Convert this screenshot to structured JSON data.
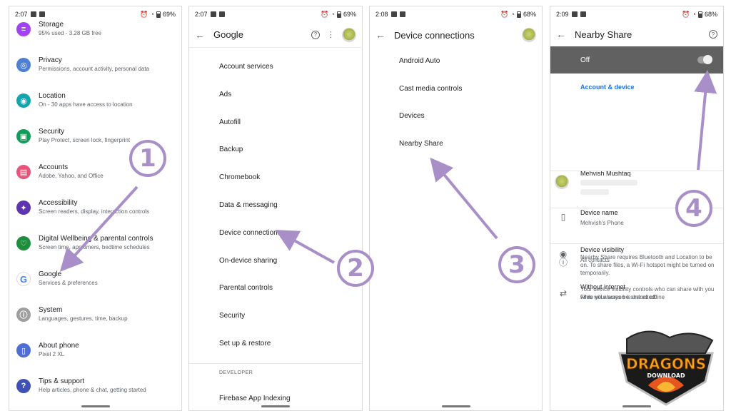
{
  "screens": [
    {
      "status": {
        "time": "2:07",
        "battery": "69%"
      },
      "items": [
        {
          "title": "Storage",
          "sub": "95% used - 3.28 GB free",
          "icon": "storage-icon",
          "color": "#a142f4"
        },
        {
          "title": "Privacy",
          "sub": "Permissions, account activity, personal data",
          "icon": "privacy-icon",
          "color": "#4e7fd6"
        },
        {
          "title": "Location",
          "sub": "On - 30 apps have access to location",
          "icon": "location-icon",
          "color": "#12a4af"
        },
        {
          "title": "Security",
          "sub": "Play Protect, screen lock, fingerprint",
          "icon": "security-icon",
          "color": "#0f9d58"
        },
        {
          "title": "Accounts",
          "sub": "Adobe, Yahoo, and Office",
          "icon": "accounts-icon",
          "color": "#e8537a"
        },
        {
          "title": "Accessibility",
          "sub": "Screen readers, display, interaction controls",
          "icon": "accessibility-icon",
          "color": "#5e35b1"
        },
        {
          "title": "Digital Wellbeing & parental controls",
          "sub": "Screen time, app timers, bedtime schedules",
          "icon": "wellbeing-icon",
          "color": "#1e8e3e"
        },
        {
          "title": "Google",
          "sub": "Services & preferences",
          "icon": "google-icon",
          "color": "#ffffff"
        },
        {
          "title": "System",
          "sub": "Languages, gestures, time, backup",
          "icon": "system-icon",
          "color": "#9e9e9e"
        },
        {
          "title": "About phone",
          "sub": "Pixel 2 XL",
          "icon": "phone-icon",
          "color": "#4e6ed6"
        },
        {
          "title": "Tips & support",
          "sub": "Help articles, phone & chat, getting started",
          "icon": "help-icon",
          "color": "#3f51b5"
        }
      ]
    },
    {
      "status": {
        "time": "2:07",
        "battery": "69%"
      },
      "title": "Google",
      "items": [
        "Account services",
        "Ads",
        "Autofill",
        "Backup",
        "Chromebook",
        "Data & messaging",
        "Device connections",
        "On-device sharing",
        "Parental controls",
        "Security",
        "Set up & restore"
      ],
      "developer_header": "DEVELOPER",
      "developer_items": [
        "Firebase App Indexing"
      ]
    },
    {
      "status": {
        "time": "2:08",
        "battery": "68%"
      },
      "title": "Device connections",
      "items": [
        "Android Auto",
        "Cast media controls",
        "Devices",
        "Nearby Share"
      ]
    },
    {
      "status": {
        "time": "2:09",
        "battery": "68%"
      },
      "title": "Nearby Share",
      "toggle_label": "Off",
      "section": "Account & device",
      "account_name": "Mehvish Mushtaq",
      "device_name_title": "Device name",
      "device_name_value": "Mehvish's Phone",
      "visibility_title": "Device visibility",
      "visibility_value": "All contacts",
      "without_internet_title": "Without internet",
      "without_internet_value": "Files will always be shared offline",
      "info1": "Nearby Share requires Bluetooth and Location to be on. To share files, a Wi-Fi hotspot might be turned on temporarily.",
      "info2": "Your device visibility controls who can share with you while your screen is unlocked."
    }
  ],
  "steps": [
    "1",
    "2",
    "3",
    "4"
  ],
  "annotation_color": "#a88fc8",
  "logo": {
    "text": "DRAGONS",
    "subtext": "DOWNLOAD"
  }
}
